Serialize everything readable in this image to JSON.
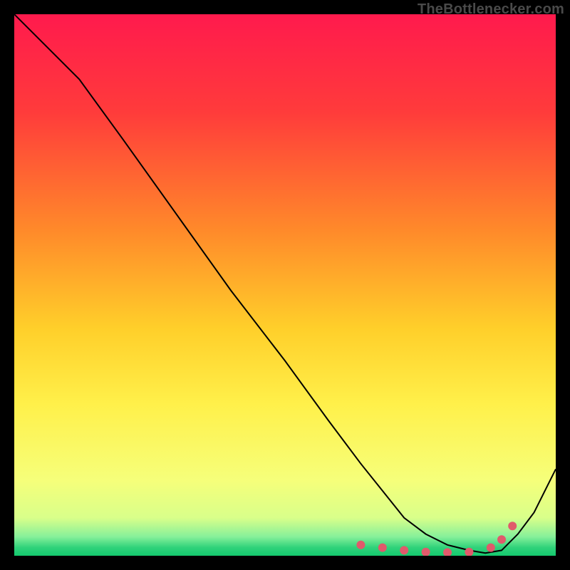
{
  "watermark": "TheBottlenecker.com",
  "chart_data": {
    "type": "line",
    "title": "",
    "xlabel": "",
    "ylabel": "",
    "xlim": [
      0,
      100
    ],
    "ylim": [
      0,
      100
    ],
    "gradient_stops": [
      {
        "offset": 0.0,
        "color": "#ff1a4d"
      },
      {
        "offset": 0.18,
        "color": "#ff3b3b"
      },
      {
        "offset": 0.4,
        "color": "#ff8a2a"
      },
      {
        "offset": 0.58,
        "color": "#ffcf2a"
      },
      {
        "offset": 0.72,
        "color": "#fff04a"
      },
      {
        "offset": 0.86,
        "color": "#f6ff7a"
      },
      {
        "offset": 0.93,
        "color": "#d9ff8a"
      },
      {
        "offset": 0.965,
        "color": "#86f09a"
      },
      {
        "offset": 0.985,
        "color": "#2fd27a"
      },
      {
        "offset": 1.0,
        "color": "#14c96e"
      }
    ],
    "curve": {
      "x": [
        0,
        6,
        12,
        20,
        30,
        40,
        50,
        58,
        64,
        68,
        72,
        76,
        80,
        84,
        87,
        90,
        93,
        96,
        100
      ],
      "y": [
        100,
        94,
        88,
        77,
        63,
        49,
        36,
        25,
        17,
        12,
        7,
        4,
        2,
        1,
        0.5,
        1,
        4,
        8,
        16
      ]
    },
    "markers": {
      "x": [
        64,
        68,
        72,
        76,
        80,
        84,
        88,
        90,
        92
      ],
      "y": [
        2,
        1.5,
        1,
        0.7,
        0.6,
        0.7,
        1.5,
        3,
        5.5
      ]
    },
    "marker_color": "#e05a6b",
    "marker_radius": 6,
    "line_color": "#000000",
    "line_width": 2
  }
}
